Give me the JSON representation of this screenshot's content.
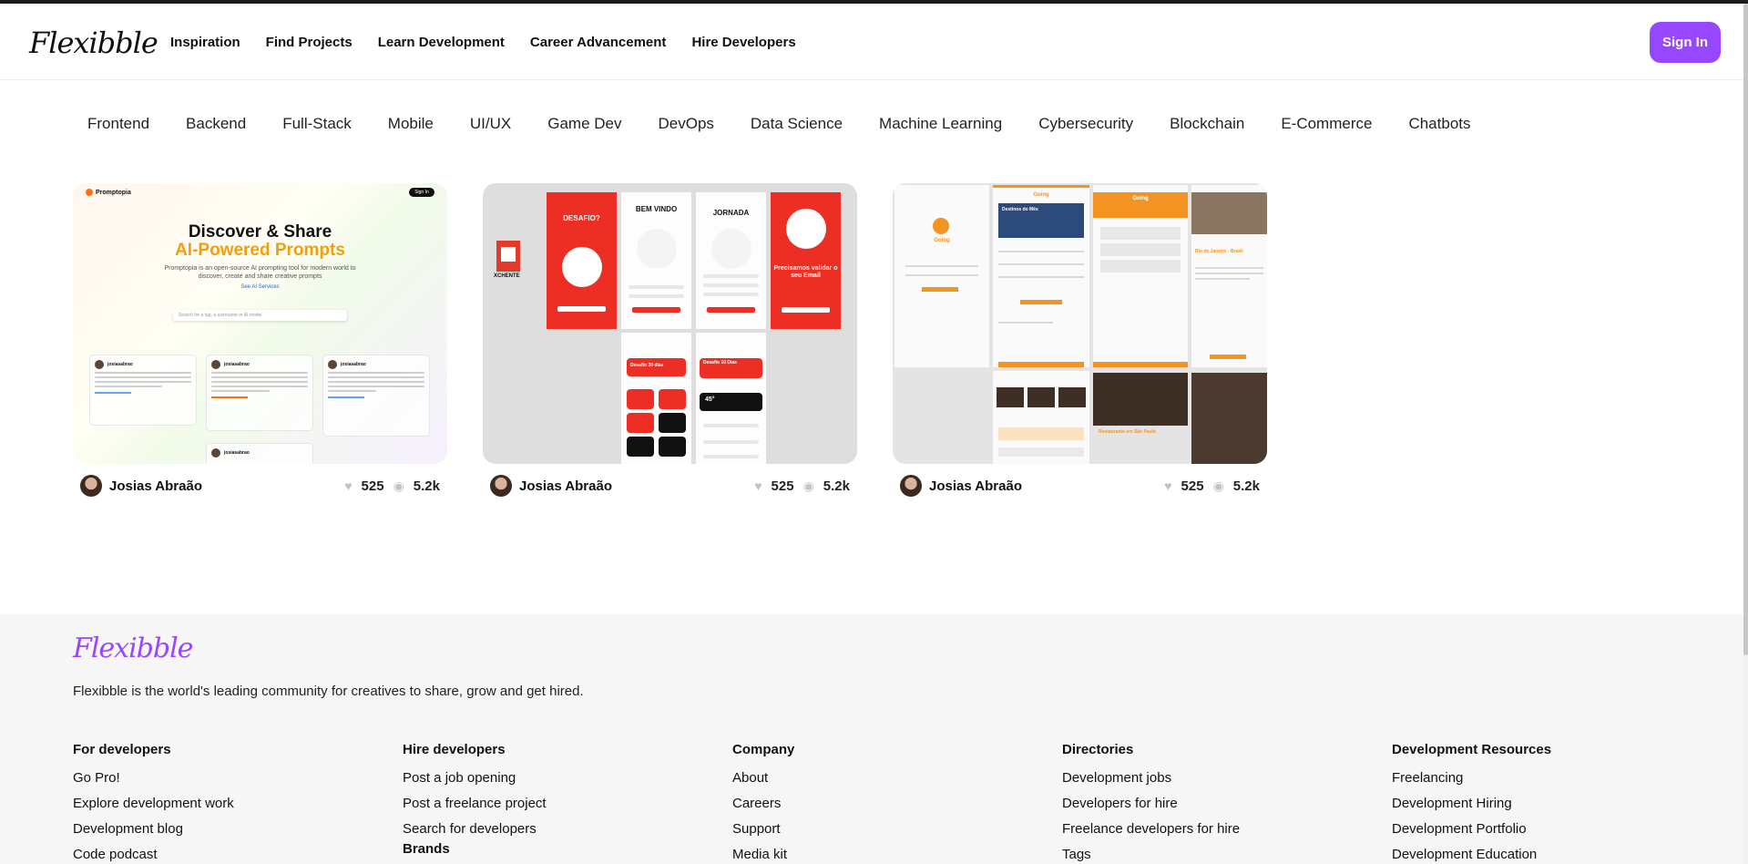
{
  "header": {
    "logo": "Flexibble",
    "nav": [
      "Inspiration",
      "Find Projects",
      "Learn Development",
      "Career Advancement",
      "Hire Developers"
    ],
    "sign_in": "Sign In"
  },
  "categories": [
    "Frontend",
    "Backend",
    "Full-Stack",
    "Mobile",
    "UI/UX",
    "Game Dev",
    "DevOps",
    "Data Science",
    "Machine Learning",
    "Cybersecurity",
    "Blockchain",
    "E-Commerce",
    "Chatbots"
  ],
  "projects": [
    {
      "author": "Josias Abraão",
      "likes": "525",
      "views": "5.2k",
      "preview": {
        "brand": "Promptopia",
        "sign_in": "Sign In",
        "headline1": "Discover & Share",
        "headline2": "AI-Powered Prompts",
        "description": "Promptopia is an open-source AI prompting tool for modern world to discover, create and share creative prompts",
        "link": "See AI Services",
        "search_placeholder": "Search for a tag, a username or AI model",
        "prompt_user": "josiasabrao"
      }
    },
    {
      "author": "Josias Abraão",
      "likes": "525",
      "views": "5.2k",
      "preview": {
        "brand": "XCHENTE",
        "title1": "DESAFIO?",
        "title2": "BEM VINDO",
        "title3": "JORNADA",
        "title4": "Precisamos validar o seu Email",
        "tile1": "Desafio 30 dias",
        "tile2": "Desafio 10 Dias",
        "count": "45°"
      }
    },
    {
      "author": "Josias Abraão",
      "likes": "525",
      "views": "5.2k",
      "preview": {
        "brand": "Going",
        "headline": "Destinos do Mês",
        "section": "Restaurante em São Paulo",
        "place": "Rio de Janeiro - Brasil"
      }
    }
  ],
  "footer": {
    "logo": "Flexibble",
    "tagline": "Flexibble is the world's leading community for creatives to share, grow and get hired.",
    "columns": [
      {
        "title": "For developers",
        "links": [
          "Go Pro!",
          "Explore development work",
          "Development blog",
          "Code podcast"
        ]
      },
      {
        "title": "Hire developers",
        "links": [
          "Post a job opening",
          "Post a freelance project",
          "Search for developers"
        ]
      },
      {
        "title": "Company",
        "links": [
          "About",
          "Careers",
          "Support",
          "Media kit"
        ]
      },
      {
        "title": "Directories",
        "links": [
          "Development jobs",
          "Developers for hire",
          "Freelance developers for hire",
          "Tags"
        ]
      },
      {
        "title": "Development Resources",
        "links": [
          "Freelancing",
          "Development Hiring",
          "Development Portfolio",
          "Development Education"
        ]
      }
    ],
    "brands_title": "Brands"
  },
  "colors": {
    "accent": "#9747ff",
    "promo_orange": "#f59e0b",
    "red": "#ec2e25",
    "travel_orange": "#f39322"
  },
  "icons": {
    "like": "heart-icon",
    "views": "eye-icon"
  }
}
